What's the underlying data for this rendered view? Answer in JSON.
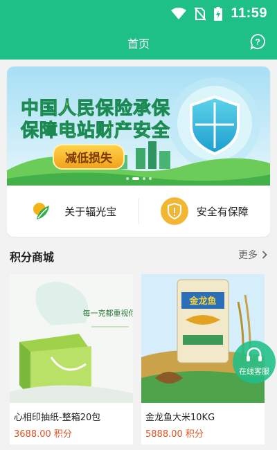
{
  "status_bar": {
    "time": "11:59",
    "icons": [
      "wifi-icon",
      "no-sim-icon",
      "battery-charging-icon"
    ]
  },
  "nav": {
    "title": "首页",
    "help_icon": "question-bubble-icon"
  },
  "banner": {
    "line1": "中国人民保险承保",
    "line2": "保障电站财产安全",
    "tag": "减低损失",
    "slide_count": 4,
    "active_slide": 1
  },
  "features": [
    {
      "label": "关于辐光宝",
      "icon": "brand-logo-icon"
    },
    {
      "label": "安全有保障",
      "icon": "shield-icon"
    }
  ],
  "mall": {
    "title": "积分商城",
    "more_label": "更多"
  },
  "products": [
    {
      "name": "心相印抽纸-整箱20包",
      "price": "3688.00",
      "unit": "积分"
    },
    {
      "name": "金龙鱼大米10KG",
      "price": "5888.00",
      "unit": "积分"
    }
  ],
  "customer_service": {
    "label": "在线客服",
    "icon": "headset-icon"
  },
  "colors": {
    "brand": "#1fbf88",
    "price": "#e0521f"
  }
}
